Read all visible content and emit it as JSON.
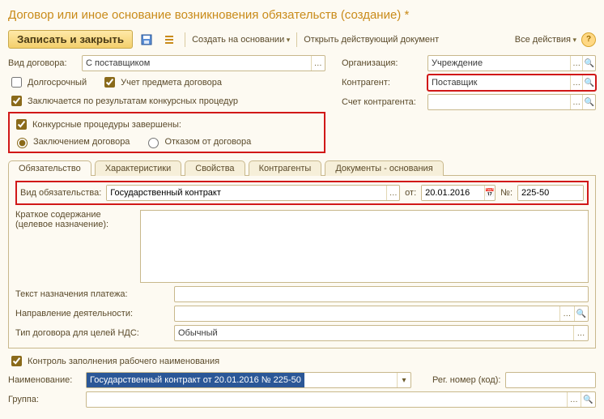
{
  "title": "Договор или иное основание возникновения обязательств (создание) *",
  "toolbar": {
    "save_close": "Записать и закрыть",
    "create_based": "Создать на основании",
    "open_doc": "Открыть действующий документ",
    "all_actions": "Все действия"
  },
  "form": {
    "contract_type_label": "Вид договора:",
    "contract_type_value": "С поставщиком",
    "org_label": "Организация:",
    "org_value": "Учреждение",
    "longterm_label": "Долгосрочный",
    "subject_label": "Учет предмета договора",
    "counterparty_label": "Контрагент:",
    "counterparty_value": "Поставщик",
    "by_tender_label": "Заключается по результатам конкурсных процедур",
    "account_label": "Счет контрагента:",
    "tender_done_label": "Конкурсные процедуры завершены:",
    "radio_contract": "Заключением договора",
    "radio_refuse": "Отказом от договора"
  },
  "tabs": {
    "t1": "Обязательство",
    "t2": "Характеристики",
    "t3": "Свойства",
    "t4": "Контрагенты",
    "t5": "Документы - основания"
  },
  "obl": {
    "type_label": "Вид обязательства:",
    "type_value": "Государственный контракт",
    "from_label": "от:",
    "date_value": "20.01.2016",
    "num_label": "№:",
    "num_value": "225-50",
    "summary_label1": "Краткое содержание",
    "summary_label2": "(целевое назначение):",
    "payment_text_label": "Текст назначения платежа:",
    "activity_label": "Направление деятельности:",
    "vat_label": "Тип договора для целей НДС:",
    "vat_value": "Обычный"
  },
  "bottom": {
    "control_label": "Контроль заполнения рабочего наименования",
    "name_label": "Наименование:",
    "name_value": "Государственный контракт от 20.01.2016 № 225-50",
    "reg_label": "Рег. номер (код):",
    "group_label": "Группа:"
  }
}
